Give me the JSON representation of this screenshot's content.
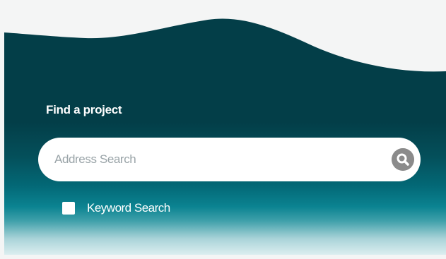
{
  "finder": {
    "title": "Find a project",
    "search": {
      "placeholder": "Address Search",
      "value": ""
    },
    "search_button_icon": "search-icon",
    "keyword": {
      "label": "Keyword Search",
      "checked": false
    }
  },
  "colors": {
    "panel_dark": "#033e48",
    "panel_teal": "#036876",
    "panel_light": "#dceeef",
    "search_button": "#8b8b8b",
    "text_light": "#ffffff"
  }
}
